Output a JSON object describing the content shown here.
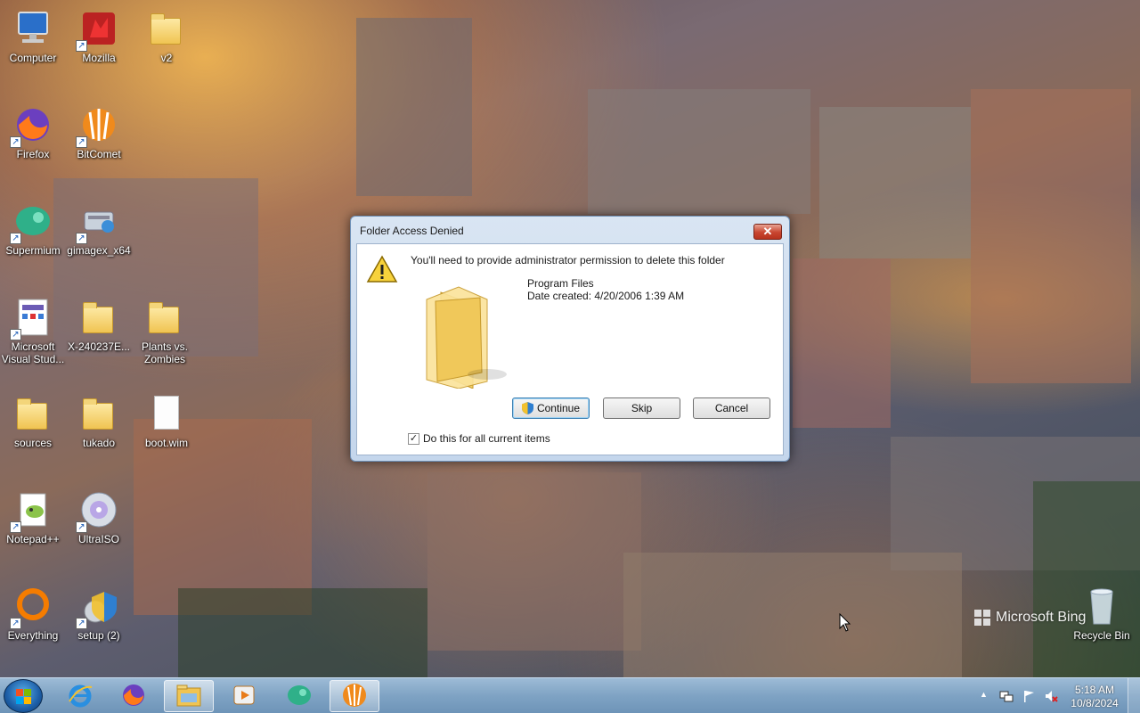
{
  "desktop": {
    "icons": [
      {
        "label": "Computer",
        "icon": "computer-icon"
      },
      {
        "label": "Mozilla",
        "icon": "mozilla-icon"
      },
      {
        "label": "v2",
        "icon": "folder-icon"
      },
      {
        "label": "Firefox",
        "icon": "firefox-icon"
      },
      {
        "label": "BitComet",
        "icon": "bitcomet-icon"
      },
      {
        "label": "Supermium",
        "icon": "supermium-icon"
      },
      {
        "label": "gimagex_x64",
        "icon": "gimagex-icon"
      },
      {
        "label": "Microsoft Visual Stud...",
        "icon": "visual-studio-icon"
      },
      {
        "label": "X-240237E...",
        "icon": "folder-icon"
      },
      {
        "label": "Plants vs. Zombies",
        "icon": "folder-icon"
      },
      {
        "label": "sources",
        "icon": "folder-icon"
      },
      {
        "label": "tukado",
        "icon": "folder-icon"
      },
      {
        "label": "boot.wim",
        "icon": "file-icon"
      },
      {
        "label": "Notepad++",
        "icon": "notepadpp-icon"
      },
      {
        "label": "UltraISO",
        "icon": "ultraiso-icon"
      },
      {
        "label": "Everything",
        "icon": "everything-icon"
      },
      {
        "label": "setup (2)",
        "icon": "setup-icon"
      },
      {
        "label": "Recycle Bin",
        "icon": "recycle-bin-icon"
      }
    ],
    "watermark": "Microsoft Bing"
  },
  "dialog": {
    "title": "Folder Access Denied",
    "close_label": "✕",
    "message": "You'll need to provide administrator permission to delete this folder",
    "item_name": "Program Files",
    "item_date": "Date created: 4/20/2006 1:39 AM",
    "buttons": {
      "continue": "Continue",
      "skip": "Skip",
      "cancel": "Cancel"
    },
    "checkbox": {
      "label": "Do this for all current items",
      "checked": true,
      "mark": "✓"
    }
  },
  "taskbar": {
    "apps": [
      {
        "name": "Internet Explorer",
        "icon": "ie-icon"
      },
      {
        "name": "Firefox",
        "icon": "firefox-icon"
      },
      {
        "name": "Windows Explorer",
        "icon": "explorer-icon",
        "active": true
      },
      {
        "name": "Media Player",
        "icon": "media-player-icon"
      },
      {
        "name": "Supermium",
        "icon": "supermium-icon"
      },
      {
        "name": "BitComet",
        "icon": "bitcomet-icon"
      }
    ],
    "clock": {
      "time": "5:18 AM",
      "date": "10/8/2024"
    },
    "tray_expand": "▲"
  },
  "colors": {
    "accent": "#1d5fa8",
    "close": "#c8452f",
    "folder": "#f0c452"
  }
}
